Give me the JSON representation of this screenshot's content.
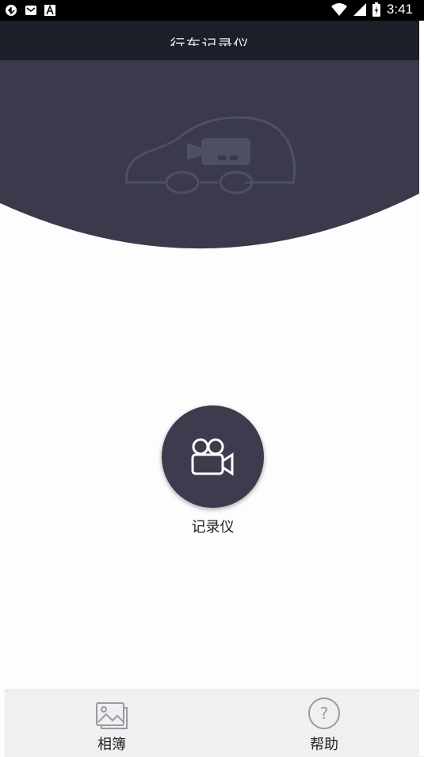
{
  "status_bar": {
    "time": "3:41",
    "left_icons": [
      "sync-icon",
      "mail-icon",
      "font-icon"
    ],
    "right_icons": [
      "wifi-icon",
      "signal-icon",
      "battery-charging-icon"
    ]
  },
  "header": {
    "title": "行车记录仪"
  },
  "main": {
    "recorder_label": "记录仪"
  },
  "bottom_nav": {
    "items": [
      {
        "label": "相簿",
        "icon": "album-icon"
      },
      {
        "label": "帮助",
        "icon": "help-icon"
      }
    ]
  },
  "colors": {
    "header_bg": "#1c1e28",
    "hero_bg": "#3a3a4c",
    "button_bg": "#3c3c4e",
    "nav_bg": "#f0f0f0"
  }
}
